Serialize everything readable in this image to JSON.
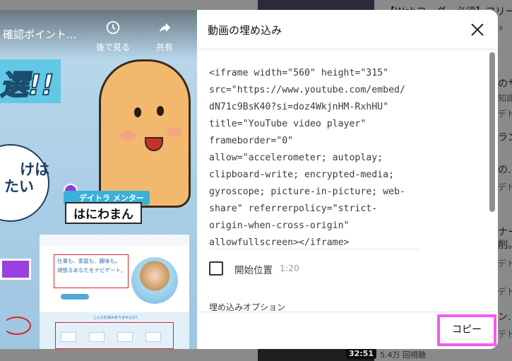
{
  "background": {
    "sidebar_texts": [
      "【Webコーダー必須】フリー素",
      "キ。",
      "のサー",
      "知識。",
      "デトラ",
      "ラン",
      "の…",
      "デトラ",
      "ナー",
      "削。",
      "デトラ",
      "デトラ",
      "ン…",
      "デトラ"
    ],
    "thumb_duration": "32:51",
    "date_text": "5.4万 回視聴"
  },
  "video": {
    "title": "確認ポイント...",
    "watch_later_label": "後で見る",
    "share_label": "共有",
    "banner_text": "選!!",
    "speech_text": [
      "けは",
      "たい"
    ],
    "mentor_tag": "デイトラ メンター",
    "mentor_name": "はにわまん",
    "site_headline": "仕事も、家庭も、趣味も。",
    "site_sub": "頑張るあなたをナビゲート。",
    "site_section": "こんなお悩みありませんか？"
  },
  "dialog": {
    "title": "動画の埋め込み",
    "code_lines": [
      "<iframe width=\"560\" height=\"315\"",
      "src=\"https://www.youtube.com/embed/",
      "dN71c9BsK40?si=doz4WkjnHM-RxhHU\"",
      "title=\"YouTube video player\"",
      "frameborder=\"0\"",
      "allow=\"accelerometer; autoplay;",
      "clipboard-write; encrypted-media;",
      "gyroscope; picture-in-picture; web-",
      "share\" referrerpolicy=\"strict-",
      "origin-when-cross-origin\"",
      "allowfullscreen></iframe>"
    ],
    "start_label": "開始位置",
    "start_time": "1:20",
    "options_heading": "埋め込みオプション",
    "copy_label": "コピー"
  },
  "colors": {
    "accent_highlight": "#f45cf1",
    "overlay": "#8a8a8a"
  }
}
